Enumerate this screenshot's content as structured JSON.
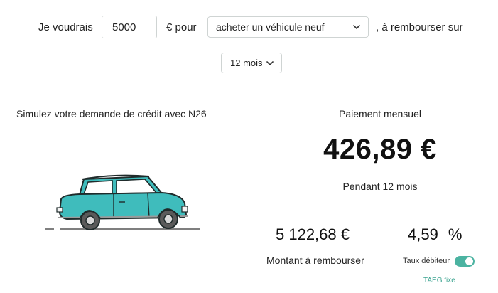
{
  "form": {
    "prefix": "Je voudrais",
    "amount_value": "5000",
    "currency_text": "€ pour",
    "purpose_selected": "acheter un véhicule neuf",
    "suffix": ", à rembourser sur",
    "duration_selected": "12 mois"
  },
  "simulator": {
    "title": "Simulez votre demande de crédit avec N26"
  },
  "result": {
    "monthly_label": "Paiement mensuel",
    "monthly_amount": "426,89 €",
    "duration_text": "Pendant 12 mois",
    "total_amount": "5 122,68 €",
    "total_label": "Montant à rembourser",
    "rate_value": "4,59",
    "rate_unit": "%",
    "rate_toggle_label": "Taux débiteur",
    "rate_toggle_on": true,
    "taeg_label": "TAEG fixe"
  },
  "colors": {
    "accent": "#4bb3a1",
    "car_body": "#3fbcbc",
    "link_green": "#3aa38f"
  },
  "icons": {
    "select_arrow": "chevron-down-icon",
    "illustration": "car-illustration"
  }
}
